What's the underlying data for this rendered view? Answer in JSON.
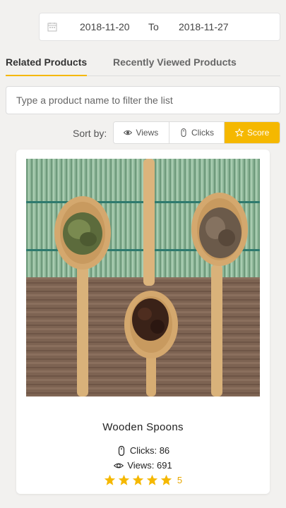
{
  "date_range": {
    "from": "2018-11-20",
    "separator": "To",
    "to": "2018-11-27",
    "icon": "calendar-icon"
  },
  "tabs": [
    {
      "label": "Related Products",
      "active": true
    },
    {
      "label": "Recently Viewed Products",
      "active": false
    }
  ],
  "filter": {
    "placeholder": "Type a product name to filter the list",
    "value": ""
  },
  "sort": {
    "label": "Sort by:",
    "options": [
      {
        "label": "Views",
        "icon": "eye-icon",
        "active": false
      },
      {
        "label": "Clicks",
        "icon": "mouse-icon",
        "active": false
      },
      {
        "label": "Score",
        "icon": "star-icon",
        "active": true
      }
    ]
  },
  "product": {
    "title": "Wooden Spoons",
    "clicks_label": "Clicks: 86",
    "views_label": "Views: 691",
    "rating": 5,
    "rating_text": "5"
  },
  "colors": {
    "accent": "#f5b800",
    "background": "#f2f1ef"
  }
}
